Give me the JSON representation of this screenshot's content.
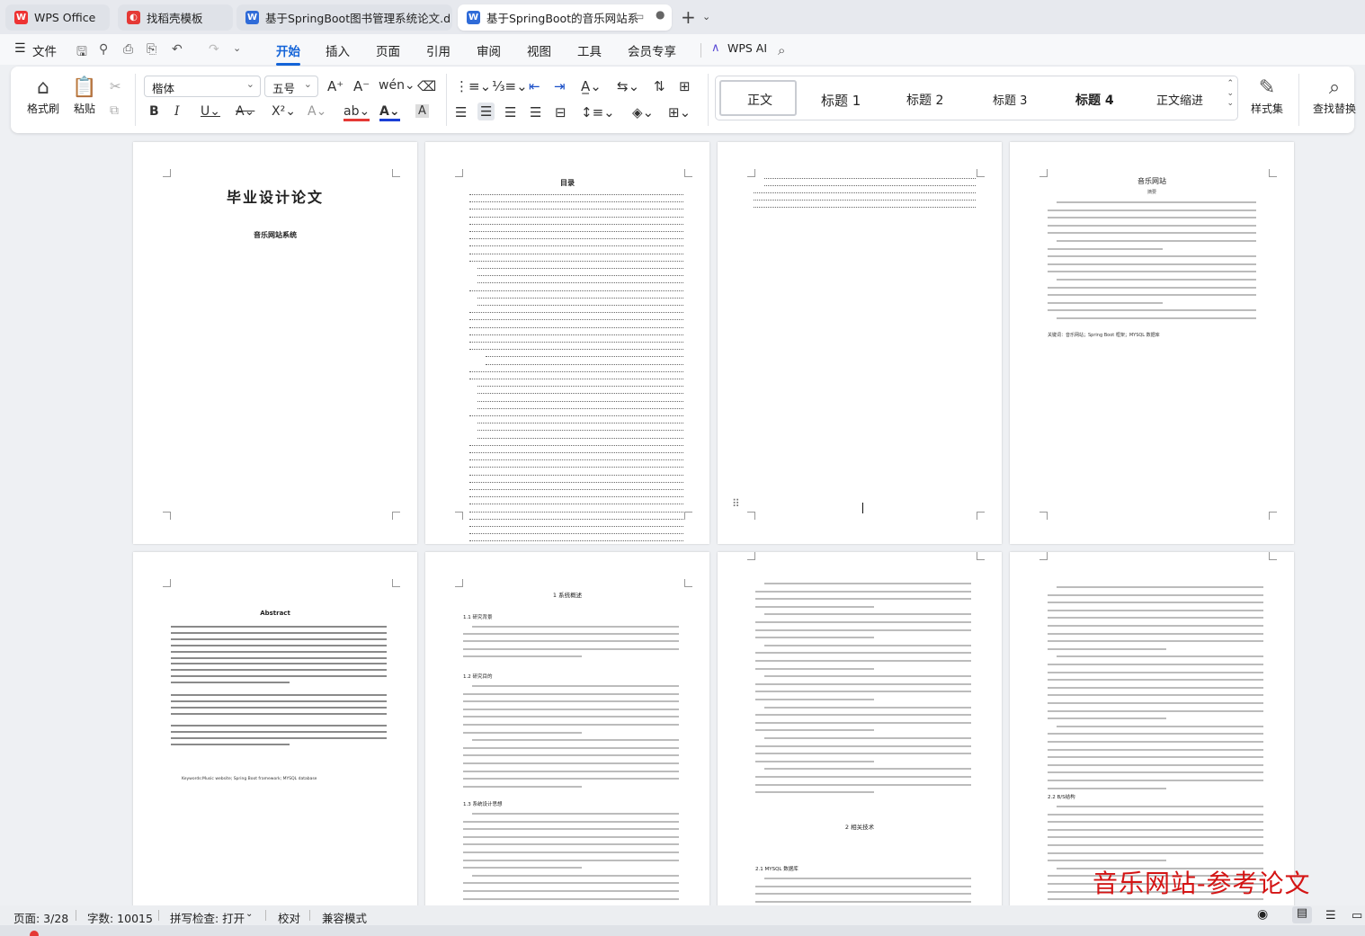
{
  "tabs": [
    {
      "label": "WPS Office",
      "active": false
    },
    {
      "label": "找稻壳模板",
      "active": false
    },
    {
      "label": "基于SpringBoot图书管理系统论文.d",
      "active": false
    },
    {
      "label": "基于SpringBoot的音乐网站系",
      "active": true
    }
  ],
  "menu": {
    "file": "文件",
    "items": [
      "开始",
      "插入",
      "页面",
      "引用",
      "审阅",
      "视图",
      "工具",
      "会员专享"
    ],
    "active": "开始",
    "wps_ai": "WPS AI"
  },
  "ribbon": {
    "format_painter": "格式刷",
    "paste": "粘贴",
    "font_name": "楷体",
    "font_size": "五号",
    "styles": [
      "正文",
      "标题 1",
      "标题 2",
      "标题 3",
      "标题 4",
      "正文缩进"
    ],
    "style_set": "样式集",
    "find_replace": "查找替换"
  },
  "pages": {
    "p1": {
      "title": "毕业设计论文",
      "subtitle": "音乐网站系统"
    },
    "p2": {
      "title": "目录"
    },
    "p4": {
      "title": "音乐网站",
      "sub": "摘要",
      "keywords": "关键词：音乐网站；Spring Boot 框架；MYSQL 数据库"
    },
    "p5": {
      "title": "Abstract",
      "keywords": "Keywords:Music website; Spring Boot framework; MYSQL database"
    },
    "p6": {
      "title": "1 系统概述",
      "h11": "1.1 研究背景",
      "h12": "1.2 研究目的",
      "h13": "1.3 系统设计思想"
    },
    "p7": {
      "h2": "2 相关技术",
      "h21": "2.1 MYSQL 数据库"
    },
    "p8": {
      "h22": "2.2 B/S结构"
    }
  },
  "status": {
    "page": "页面: 3/28",
    "words": "字数: 10015",
    "spell": "拼写检查: 打开",
    "proof": "校对",
    "compat": "兼容模式"
  },
  "watermark": "音乐网站-参考论文",
  "colors": {
    "accent": "#1464d8",
    "watermark": "#d41414"
  }
}
